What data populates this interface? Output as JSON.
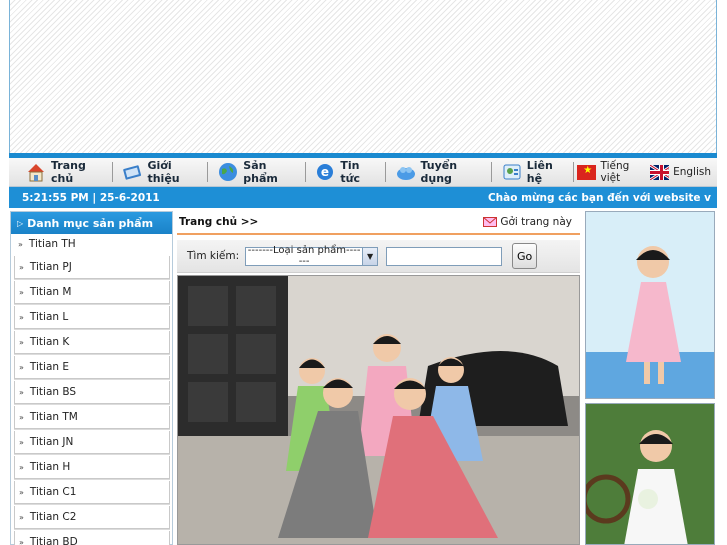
{
  "nav": {
    "items": [
      {
        "label": "Trang chủ",
        "icon": "home-icon"
      },
      {
        "label": "Giới thiệu",
        "icon": "book-icon"
      },
      {
        "label": "Sản phẩm",
        "icon": "globe-icon"
      },
      {
        "label": "Tin tức",
        "icon": "browser-e-icon"
      },
      {
        "label": "Tuyển dụng",
        "icon": "people-icon"
      },
      {
        "label": "Liên hệ",
        "icon": "contact-card-icon"
      }
    ],
    "lang_vi": "Tiếng việt",
    "lang_en": "English"
  },
  "status": {
    "datetime": "5:21:55 PM | 25-6-2011",
    "marquee": "Chào mừng các bạn đến với website v"
  },
  "sidebar": {
    "title": "Danh mục sản phẩm",
    "items": [
      "Titian TH",
      "Titian PJ",
      "Titian M",
      "Titian L",
      "Titian K",
      "Titian E",
      "Titian BS",
      "Titian TM",
      "Titian JN",
      "Titian H",
      "Titian C1",
      "Titian C2",
      "Titian BD"
    ]
  },
  "main": {
    "breadcrumb": "Trang chủ >>",
    "send_page": "Gởi trang này",
    "search_label": "Tìm kiếm:",
    "select_value": "-------Loại sản phẩm-------",
    "go_label": "Go"
  },
  "colors": {
    "accent": "#1e8fd6",
    "divider": "#f0a060"
  }
}
